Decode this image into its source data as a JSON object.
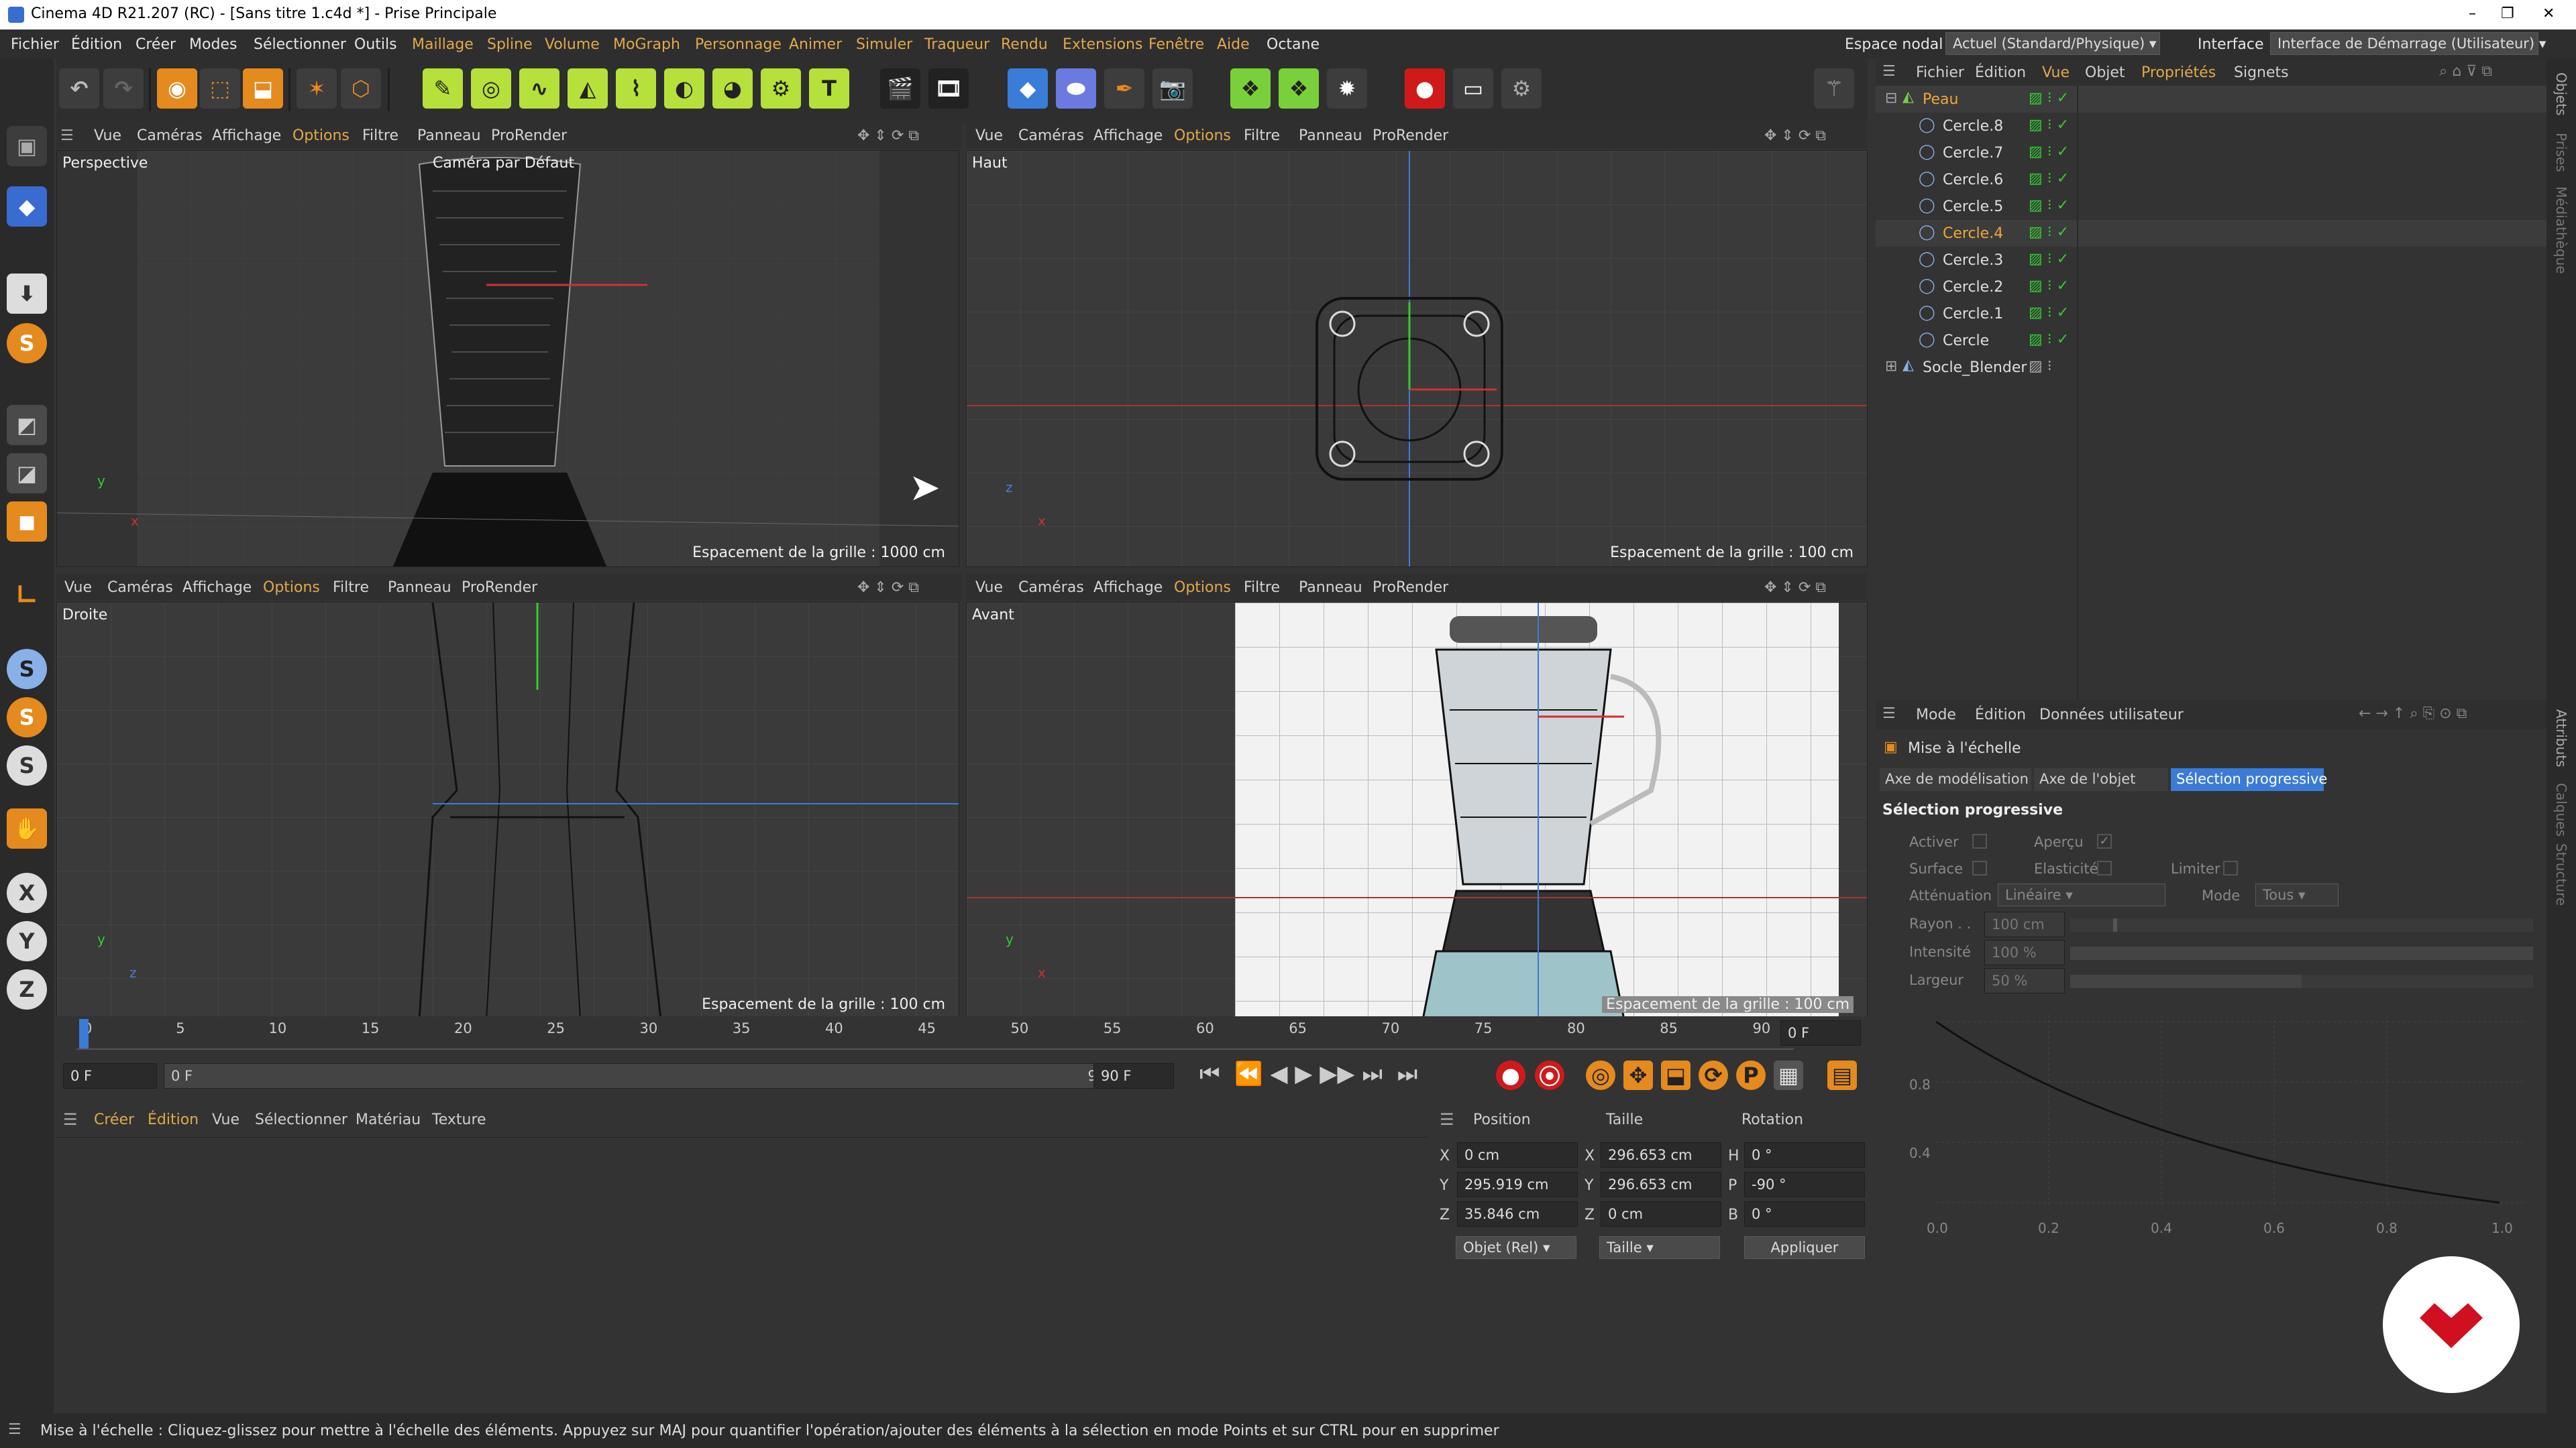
{
  "window": {
    "title": "Cinema 4D R21.207 (RC) - [Sans titre 1.c4d *] - Prise Principale",
    "controls": [
      "–",
      "❐",
      "✕"
    ]
  },
  "menubar": {
    "items": [
      "Fichier",
      "Édition",
      "Créer",
      "Modes",
      "Sélectionner",
      "Outils",
      "Maillage",
      "Spline",
      "Volume",
      "MoGraph",
      "Personnage",
      "Animer",
      "Simuler",
      "Traqueur",
      "Rendu",
      "Extensions",
      "Fenêtre",
      "Aide",
      "Octane"
    ],
    "nodal_label": "Espace nodal :",
    "nodal_value": "Actuel (Standard/Physique)",
    "interface_label": "Interface :",
    "interface_value": "Interface de Démarrage (Utilisateur)"
  },
  "viewports": {
    "menu": [
      "Vue",
      "Caméras",
      "Affichage",
      "Options",
      "Filtre",
      "Panneau",
      "ProRender"
    ],
    "perspective": {
      "label": "Perspective",
      "camera": "Caméra par Défaut",
      "spacing": "Espacement de la grille : 1000 cm"
    },
    "top": {
      "label": "Haut",
      "spacing": "Espacement de la grille : 100 cm"
    },
    "right": {
      "label": "Droite",
      "spacing": "Espacement de la grille : 100 cm"
    },
    "front": {
      "label": "Avant",
      "spacing": "Espacement de la grille : 100 cm"
    },
    "axes": {
      "x": "x",
      "y": "y",
      "z": "z"
    }
  },
  "object_manager": {
    "menu": [
      "Fichier",
      "Édition",
      "Vue",
      "Objet",
      "Propriétés",
      "Signets"
    ],
    "objects": [
      {
        "name": "Peau",
        "selected": true,
        "level": 0
      },
      {
        "name": "Cercle.8",
        "selected": false,
        "level": 1
      },
      {
        "name": "Cercle.7",
        "selected": false,
        "level": 1
      },
      {
        "name": "Cercle.6",
        "selected": false,
        "level": 1
      },
      {
        "name": "Cercle.5",
        "selected": false,
        "level": 1
      },
      {
        "name": "Cercle.4",
        "selected": true,
        "level": 1
      },
      {
        "name": "Cercle.3",
        "selected": false,
        "level": 1
      },
      {
        "name": "Cercle.2",
        "selected": false,
        "level": 1
      },
      {
        "name": "Cercle.1",
        "selected": false,
        "level": 1
      },
      {
        "name": "Cercle",
        "selected": false,
        "level": 1
      },
      {
        "name": "Socle_Blender",
        "selected": false,
        "level": 0
      }
    ],
    "side_tabs": [
      "Objets",
      "Prises",
      "Médiathèque"
    ]
  },
  "attributes": {
    "menu": [
      "Mode",
      "Édition",
      "Données utilisateur"
    ],
    "tool": "Mise à l'échelle",
    "tabs": [
      "Axe de modélisation",
      "Axe de l'objet",
      "Sélection progressive"
    ],
    "section": "Sélection progressive",
    "activer": "Activer",
    "apercu": "Aperçu",
    "surface": "Surface",
    "elasticite": "Elasticité",
    "limiter": "Limiter",
    "attenuation_label": "Atténuation",
    "attenuation_value": "Linéaire",
    "mode_label": "Mode",
    "mode_value": "Tous",
    "rayon_label": "Rayon . .",
    "rayon_value": "100 cm",
    "intensite_label": "Intensité",
    "intensite_value": "100 %",
    "largeur_label": "Largeur",
    "largeur_value": "50 %",
    "graph_y": [
      "0.8",
      "0.4"
    ],
    "graph_x": [
      "0.0",
      "0.2",
      "0.4",
      "0.6",
      "0.8",
      "1.0"
    ],
    "side_tabs": [
      "Attributs",
      "Calques",
      "Structure"
    ]
  },
  "timeline": {
    "ticks": [
      "0",
      "5",
      "10",
      "15",
      "20",
      "25",
      "30",
      "35",
      "40",
      "45",
      "50",
      "55",
      "60",
      "65",
      "70",
      "75",
      "80",
      "85",
      "90"
    ],
    "current_frame": "0 F",
    "start": "0 F",
    "range_start": "0 F",
    "range_end": "90 F",
    "end": "90 F"
  },
  "material_manager": {
    "menu": [
      "Créer",
      "Édition",
      "Vue",
      "Sélectionner",
      "Matériau",
      "Texture"
    ]
  },
  "coordinates": {
    "headers": [
      "Position",
      "Taille",
      "Rotation"
    ],
    "rows": [
      {
        "axis": "X",
        "pos": "0 cm",
        "size_axis": "X",
        "size": "296.653 cm",
        "rot_axis": "H",
        "rot": "0 °"
      },
      {
        "axis": "Y",
        "pos": "295.919 cm",
        "size_axis": "Y",
        "size": "296.653 cm",
        "rot_axis": "P",
        "rot": "-90 °"
      },
      {
        "axis": "Z",
        "pos": "35.846 cm",
        "size_axis": "Z",
        "size": "0 cm",
        "rot_axis": "B",
        "rot": "0 °"
      }
    ],
    "mode": "Objet (Rel)",
    "size_mode": "Taille",
    "apply": "Appliquer"
  },
  "status": "Mise à l'échelle : Cliquez-glissez pour mettre à l'échelle des éléments. Appuyez sur MAJ pour quantifier l'opération/ajouter des éléments à la sélection en mode Points et sur CTRL pour en supprimer",
  "colors": {
    "accent": "#e3a84a",
    "selection_blue": "#3b7bd8"
  }
}
